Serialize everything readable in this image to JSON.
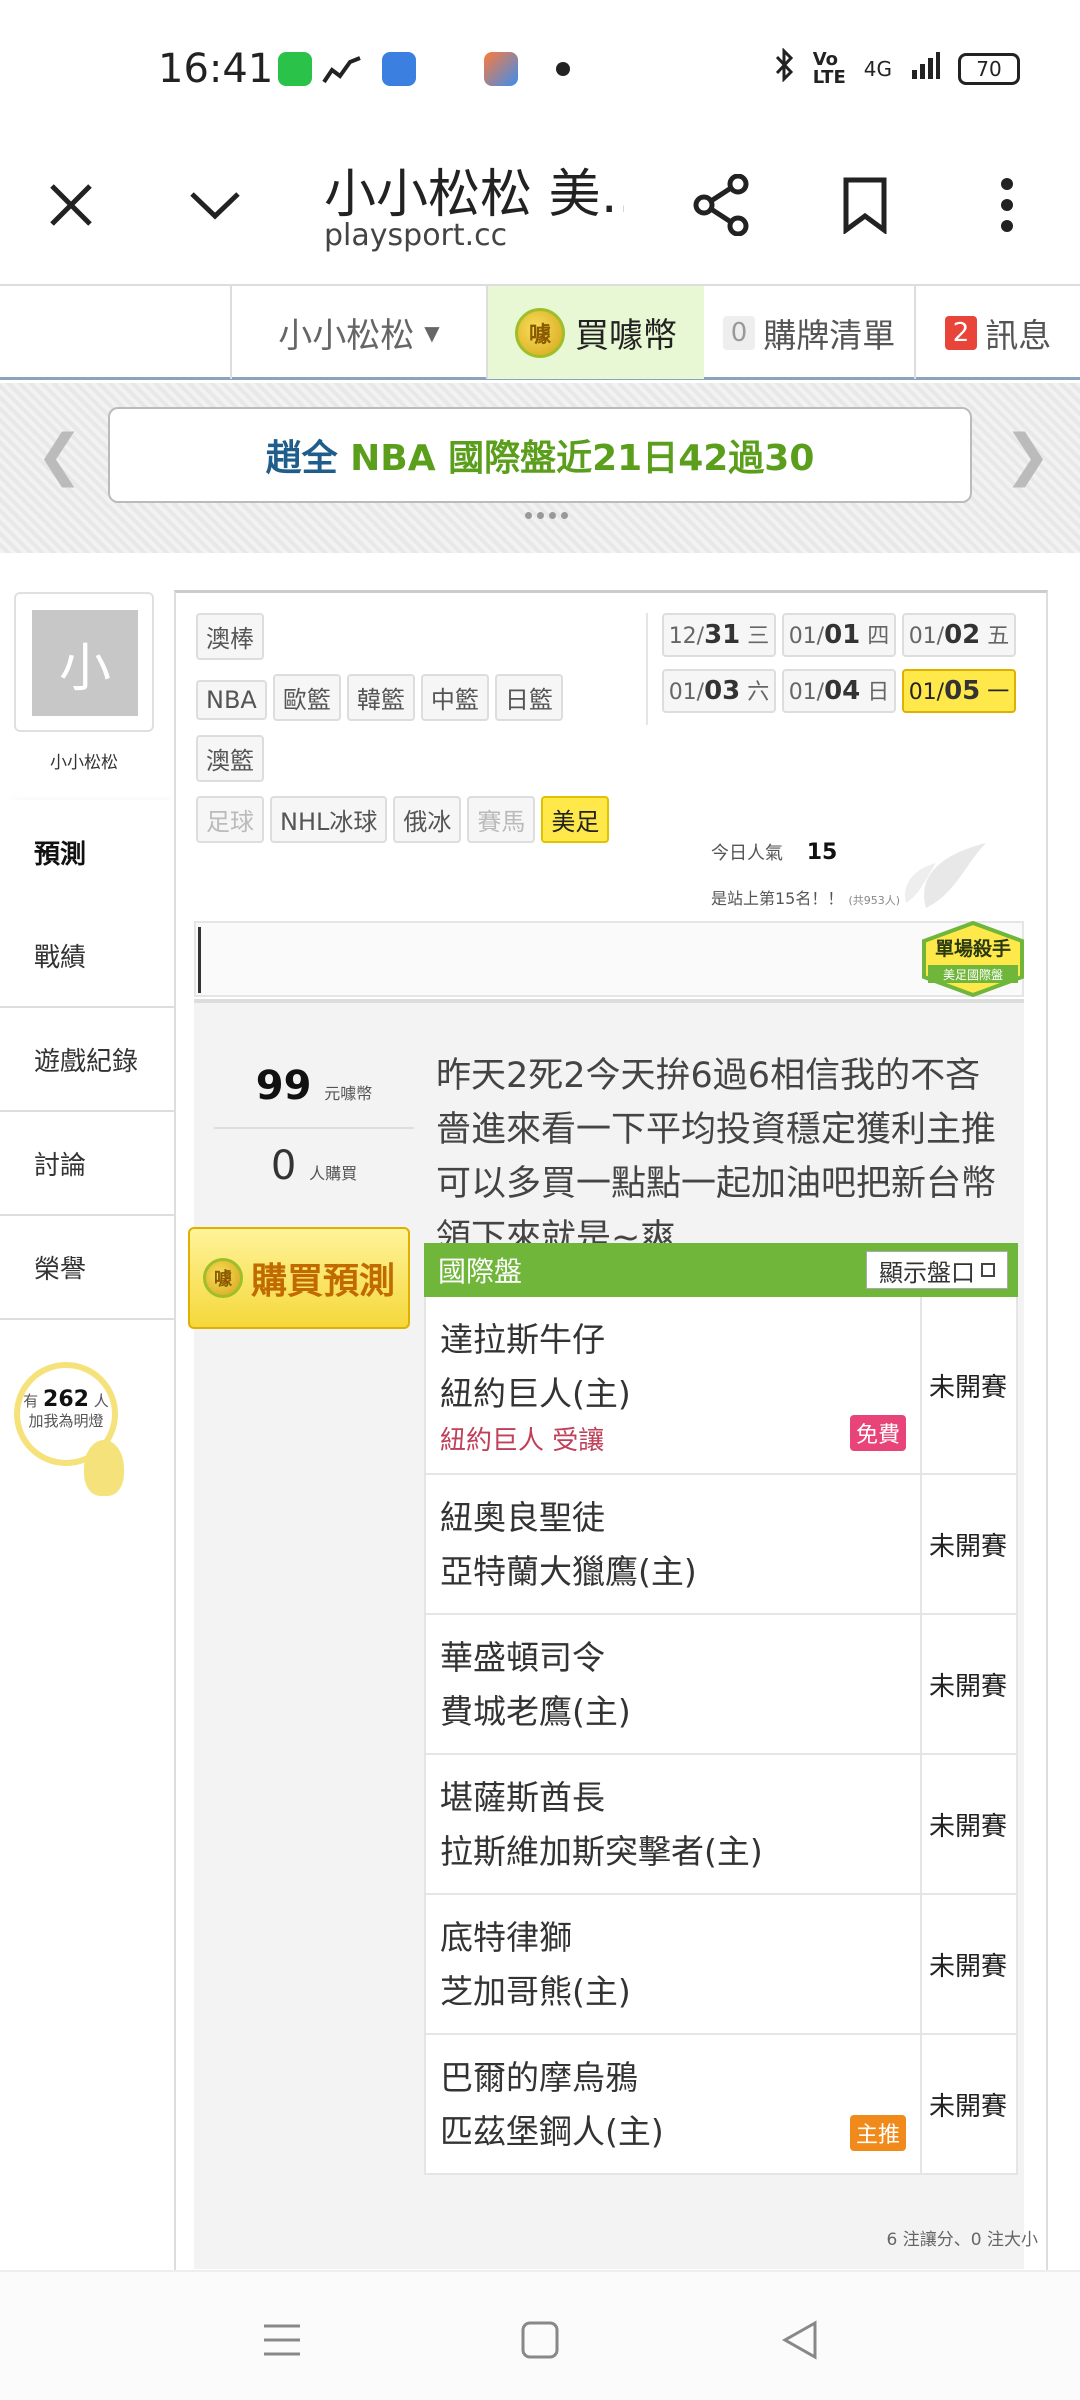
{
  "status_bar": {
    "time": "16:41",
    "battery": "70",
    "network": "4G",
    "icons": [
      "bluetooth-icon",
      "volte-icon",
      "signal-icon"
    ]
  },
  "browser": {
    "title": "小小松松 美…",
    "domain": "playsport.cc",
    "icons": [
      "close-icon",
      "chevron-down-icon",
      "share-icon",
      "bookmark-icon",
      "more-vertical-icon"
    ]
  },
  "site_nav": {
    "user": "小小松松",
    "buy_coins": "買噱幣",
    "coin_label": "噱",
    "cart_count": "0",
    "cart_label": "購牌清單",
    "msg_count": "2",
    "msg_label": "訊息"
  },
  "banner": {
    "text_part1": "趙全",
    "text_part2": "NBA 國際盤近21日42過30"
  },
  "profile": {
    "avatar_char": "小",
    "name": "小小松松"
  },
  "side_menu": [
    {
      "label": "預測",
      "active": true
    },
    {
      "label": "戰績",
      "active": false
    },
    {
      "label": "遊戲紀錄",
      "active": false
    },
    {
      "label": "討論",
      "active": false
    },
    {
      "label": "榮譽",
      "active": false
    }
  ],
  "fans": {
    "prefix": "有",
    "count": "262",
    "unit": "人",
    "label": "加我為明燈"
  },
  "leagues": [
    {
      "label": "澳棒",
      "state": "normal"
    },
    {
      "label": "NBA",
      "state": "normal"
    },
    {
      "label": "歐籃",
      "state": "normal"
    },
    {
      "label": "韓籃",
      "state": "normal"
    },
    {
      "label": "中籃",
      "state": "normal"
    },
    {
      "label": "日籃",
      "state": "normal"
    },
    {
      "label": "澳籃",
      "state": "normal"
    },
    {
      "label": "足球",
      "state": "disabled"
    },
    {
      "label": "NHL冰球",
      "state": "normal"
    },
    {
      "label": "俄冰",
      "state": "normal"
    },
    {
      "label": "賽馬",
      "state": "disabled"
    },
    {
      "label": "美足",
      "state": "active"
    }
  ],
  "dates": [
    {
      "month": "12/",
      "day": "31",
      "weekday": "三",
      "active": false
    },
    {
      "month": "01/",
      "day": "01",
      "weekday": "四",
      "active": false
    },
    {
      "month": "01/",
      "day": "02",
      "weekday": "五",
      "active": false
    },
    {
      "month": "01/",
      "day": "03",
      "weekday": "六",
      "active": false
    },
    {
      "month": "01/",
      "day": "04",
      "weekday": "日",
      "active": false
    },
    {
      "month": "01/",
      "day": "05",
      "weekday": "一",
      "active": true
    }
  ],
  "popularity": {
    "label": "今日人氣",
    "value": "15",
    "rank_text": "是站上第15名！！",
    "rank_total": "(共953人)"
  },
  "badge_killer": {
    "line1": "單場殺手",
    "line2": "美足國際盤"
  },
  "prediction": {
    "price": "99",
    "price_unit": "元噱幣",
    "buyers": "0",
    "buyers_unit": "人購買",
    "buy_button": "購買預測",
    "comment": "昨天2死2今天拚6過6相信我的不吝嗇進來看一下平均投資穩定獲利主推可以多買一點點一起加油吧把新台幣領下來就是~爽",
    "table_title": "國際盤",
    "show_odds": "顯示盤口",
    "games": [
      {
        "away": "達拉斯牛仔",
        "home": "紐約巨人(主)",
        "pick": "紐約巨人 受讓",
        "tag": "免費",
        "tag_type": "free",
        "status": "未開賽"
      },
      {
        "away": "紐奧良聖徒",
        "home": "亞特蘭大獵鷹(主)",
        "pick": "",
        "tag": "",
        "tag_type": "",
        "status": "未開賽"
      },
      {
        "away": "華盛頓司令",
        "home": "費城老鷹(主)",
        "pick": "",
        "tag": "",
        "tag_type": "",
        "status": "未開賽"
      },
      {
        "away": "堪薩斯酋長",
        "home": "拉斯維加斯突擊者(主)",
        "pick": "",
        "tag": "",
        "tag_type": "",
        "status": "未開賽"
      },
      {
        "away": "底特律獅",
        "home": "芝加哥熊(主)",
        "pick": "",
        "tag": "",
        "tag_type": "",
        "status": "未開賽"
      },
      {
        "away": "巴爾的摩烏鴉",
        "home": "匹茲堡鋼人(主)",
        "pick": "",
        "tag": "主推",
        "tag_type": "main",
        "status": "未開賽"
      }
    ],
    "summary": "6 注讓分、0 注大小"
  },
  "nav_bar": [
    "menu-icon",
    "home-square-icon",
    "back-triangle-icon"
  ],
  "colors": {
    "accent_green": "#6fb63a",
    "highlight_yellow": "#ffe94a",
    "banner_blue": "#1f5e8c",
    "banner_green": "#5a9e1c"
  }
}
